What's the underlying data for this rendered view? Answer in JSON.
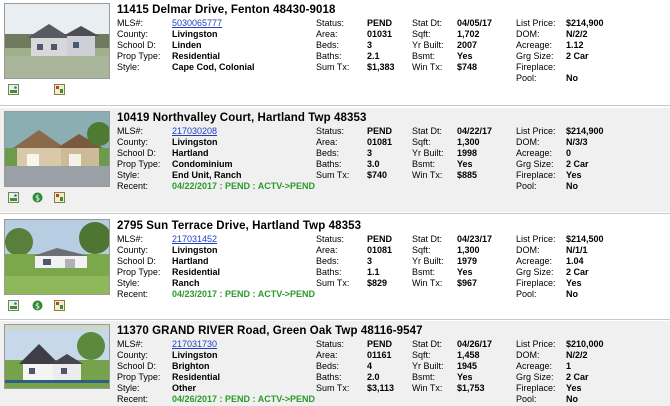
{
  "field_labels": {
    "mls": "MLS#:",
    "county": "County:",
    "school": "School D:",
    "prop_type": "Prop Type:",
    "style": "Style:",
    "recent": "Recent:",
    "status": "Status:",
    "area": "Area:",
    "beds": "Beds:",
    "baths": "Baths:",
    "sum_tx": "Sum Tx:",
    "stat_dt": "Stat Dt:",
    "sqft": "Sqft:",
    "yr_built": "Yr Built:",
    "bsmt": "Bsmt:",
    "win_tx": "Win Tx:",
    "list_price": "List Price:",
    "dom": "DOM:",
    "acreage": "Acreage:",
    "grg_size": "Grg Size:",
    "fireplace": "Fireplace:",
    "pool": "Pool:"
  },
  "icons": {
    "photo": "photo-gallery-icon",
    "map": "map-icon",
    "history": "history-icon"
  },
  "colors": {
    "link": "#1f3fbf",
    "recent": "#2a9a2a",
    "row_shade": "#f0f0f0"
  },
  "listings": [
    {
      "address": "11415 Delmar Drive, Fenton 48430-9018",
      "mls": "5030065777",
      "county": "Livingston",
      "school": "Linden",
      "prop_type": "Residential",
      "style": "Cape Cod, Colonial",
      "recent": "",
      "status": "PEND",
      "area": "01031",
      "beds": "3",
      "baths": "2.1",
      "sum_tx": "$1,383",
      "stat_dt": "04/05/17",
      "sqft": "1,702",
      "yr_built": "2007",
      "bsmt": "Yes",
      "win_tx": "$748",
      "list_price": "$214,900",
      "dom": "N/2/2",
      "acreage": "1.12",
      "grg_size": "2 Car",
      "fireplace": "",
      "pool": "No"
    },
    {
      "address": "10419 Northvalley Court, Hartland Twp 48353",
      "mls": "217030208",
      "county": "Livingston",
      "school": "Hartland",
      "prop_type": "Condominium",
      "style": "End Unit, Ranch",
      "recent": "04/22/2017 : PEND : ACTV->PEND",
      "status": "PEND",
      "area": "01081",
      "beds": "3",
      "baths": "3.0",
      "sum_tx": "$740",
      "stat_dt": "04/22/17",
      "sqft": "1,300",
      "yr_built": "1998",
      "bsmt": "Yes",
      "win_tx": "$885",
      "list_price": "$214,900",
      "dom": "N/3/3",
      "acreage": "0",
      "grg_size": "2 Car",
      "fireplace": "Yes",
      "pool": "No"
    },
    {
      "address": "2795 Sun Terrace Drive, Hartland Twp 48353",
      "mls": "217031452",
      "county": "Livingston",
      "school": "Hartland",
      "prop_type": "Residential",
      "style": "Ranch",
      "recent": "04/23/2017 : PEND : ACTV->PEND",
      "status": "PEND",
      "area": "01081",
      "beds": "3",
      "baths": "1.1",
      "sum_tx": "$829",
      "stat_dt": "04/23/17",
      "sqft": "1,300",
      "yr_built": "1979",
      "bsmt": "Yes",
      "win_tx": "$967",
      "list_price": "$214,500",
      "dom": "N/1/1",
      "acreage": "1.04",
      "grg_size": "2 Car",
      "fireplace": "Yes",
      "pool": "No"
    },
    {
      "address": "11370 GRAND RIVER Road, Green Oak Twp 48116-9547",
      "mls": "217031730",
      "county": "Livingston",
      "school": "Brighton",
      "prop_type": "Residential",
      "style": "Other",
      "recent": "04/26/2017 : PEND : ACTV->PEND",
      "status": "PEND",
      "area": "01161",
      "beds": "4",
      "baths": "2.0",
      "sum_tx": "$3,113",
      "stat_dt": "04/26/17",
      "sqft": "1,458",
      "yr_built": "1945",
      "bsmt": "Yes",
      "win_tx": "$1,753",
      "list_price": "$210,000",
      "dom": "N/2/2",
      "acreage": "1",
      "grg_size": "2 Car",
      "fireplace": "Yes",
      "pool": "No"
    }
  ]
}
